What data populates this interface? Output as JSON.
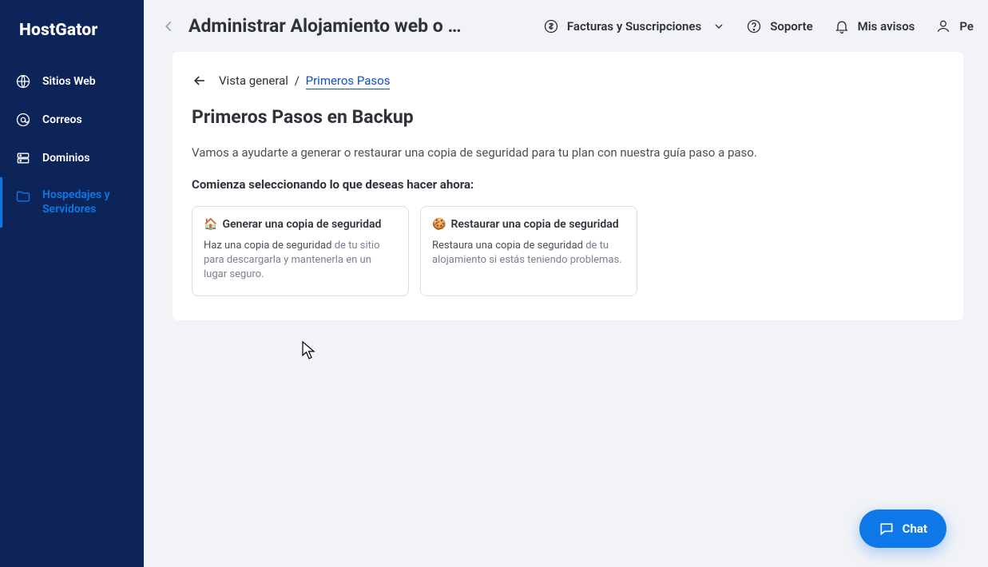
{
  "brand": "HostGator",
  "sidebar": {
    "items": [
      {
        "label": "Sitios Web"
      },
      {
        "label": "Correos"
      },
      {
        "label": "Dominios"
      },
      {
        "label": "Hospedajes y Servidores"
      }
    ]
  },
  "topbar": {
    "page_title": "Administrar Alojamiento web o …",
    "billing": "Facturas y Suscripciones",
    "support": "Soporte",
    "notifications": "Mis avisos",
    "profile_prefix": "Pe"
  },
  "breadcrumb": {
    "root": "Vista general",
    "current": "Primeros Pasos"
  },
  "main": {
    "title": "Primeros Pasos en Backup",
    "description": "Vamos a ayudarte a generar o restaurar una copia de seguridad para tu plan con nuestra guía paso a paso.",
    "subheading": "Comienza seleccionando lo que deseas hacer ahora:"
  },
  "cards": [
    {
      "icon": "🏠",
      "title": "Generar una copia de seguridad",
      "desc_strong": "Haz una copia de seguridad",
      "desc_rest": " de tu sitio para descargarla y mantenerla en un lugar seguro."
    },
    {
      "icon": "🍪",
      "title": "Restaurar una copia de seguridad",
      "desc_strong": "Restaura una copia de seguridad",
      "desc_rest": " de tu alojamiento si estás teniendo problemas."
    }
  ],
  "chat_label": "Chat"
}
